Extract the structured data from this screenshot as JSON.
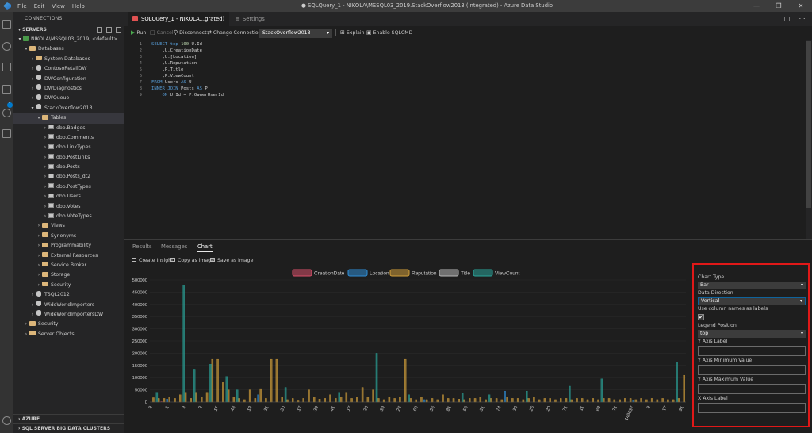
{
  "titlebar": {
    "menu": [
      "File",
      "Edit",
      "View",
      "Help"
    ],
    "window_title": "● SQLQuery_1 - NIKOLA\\MSSQL03_2019.StackOverflow2013 (Integrated) - Azure Data Studio"
  },
  "activity_badge": "1",
  "sidebar": {
    "section_title": "CONNECTIONS",
    "servers_label": "SERVERS",
    "tree": [
      {
        "label": "NIKOLA\\MSSQL03_2019, <default>...",
        "icon": "server",
        "chevron": "▾",
        "indent": 0
      },
      {
        "label": "Databases",
        "icon": "folder",
        "chevron": "▾",
        "indent": 1
      },
      {
        "label": "System Databases",
        "icon": "folder",
        "chevron": "›",
        "indent": 2
      },
      {
        "label": "ContosoRetailDW",
        "icon": "db",
        "chevron": "›",
        "indent": 2
      },
      {
        "label": "DWConfiguration",
        "icon": "db",
        "chevron": "›",
        "indent": 2
      },
      {
        "label": "DWDiagnostics",
        "icon": "db",
        "chevron": "›",
        "indent": 2
      },
      {
        "label": "DWQueue",
        "icon": "db",
        "chevron": "›",
        "indent": 2
      },
      {
        "label": "StackOverflow2013",
        "icon": "db",
        "chevron": "▾",
        "indent": 2
      },
      {
        "label": "Tables",
        "icon": "folder",
        "chevron": "▾",
        "indent": 3,
        "selected": true
      },
      {
        "label": "dbo.Badges",
        "icon": "table",
        "chevron": "›",
        "indent": 4
      },
      {
        "label": "dbo.Comments",
        "icon": "table",
        "chevron": "›",
        "indent": 4
      },
      {
        "label": "dbo.LinkTypes",
        "icon": "table",
        "chevron": "›",
        "indent": 4
      },
      {
        "label": "dbo.PostLinks",
        "icon": "table",
        "chevron": "›",
        "indent": 4
      },
      {
        "label": "dbo.Posts",
        "icon": "table",
        "chevron": "›",
        "indent": 4
      },
      {
        "label": "dbo.Posts_dt2",
        "icon": "table",
        "chevron": "›",
        "indent": 4
      },
      {
        "label": "dbo.PostTypes",
        "icon": "table",
        "chevron": "›",
        "indent": 4
      },
      {
        "label": "dbo.Users",
        "icon": "table",
        "chevron": "›",
        "indent": 4
      },
      {
        "label": "dbo.Votes",
        "icon": "table",
        "chevron": "›",
        "indent": 4
      },
      {
        "label": "dbo.VoteTypes",
        "icon": "table",
        "chevron": "›",
        "indent": 4
      },
      {
        "label": "Views",
        "icon": "folder",
        "chevron": "›",
        "indent": 3
      },
      {
        "label": "Synonyms",
        "icon": "folder",
        "chevron": "›",
        "indent": 3
      },
      {
        "label": "Programmability",
        "icon": "folder",
        "chevron": "›",
        "indent": 3
      },
      {
        "label": "External Resources",
        "icon": "folder",
        "chevron": "›",
        "indent": 3
      },
      {
        "label": "Service Broker",
        "icon": "folder",
        "chevron": "›",
        "indent": 3
      },
      {
        "label": "Storage",
        "icon": "folder",
        "chevron": "›",
        "indent": 3
      },
      {
        "label": "Security",
        "icon": "folder",
        "chevron": "›",
        "indent": 3
      },
      {
        "label": "TSQL2012",
        "icon": "db",
        "chevron": "›",
        "indent": 2
      },
      {
        "label": "WideWorldImporters",
        "icon": "db",
        "chevron": "›",
        "indent": 2
      },
      {
        "label": "WideWorldImportersDW",
        "icon": "db",
        "chevron": "›",
        "indent": 2
      },
      {
        "label": "Security",
        "icon": "folder",
        "chevron": "›",
        "indent": 1
      },
      {
        "label": "Server Objects",
        "icon": "folder",
        "chevron": "›",
        "indent": 1
      }
    ],
    "azure_label": "AZURE",
    "bigdata_label": "SQL SERVER BIG DATA CLUSTERS"
  },
  "tabs": {
    "query_tab": "SQLQuery_1 - NIKOLA...grated)",
    "settings_tab": "Settings"
  },
  "toolbar": {
    "run": "Run",
    "cancel": "Cancel",
    "disconnect": "Disconnect",
    "change_connection": "Change Connection",
    "database": "StackOverflow2013",
    "explain": "Explain",
    "enable_sqlcmd": "Enable SQLCMD"
  },
  "code": [
    {
      "n": "1",
      "parts": [
        [
          "kw",
          "SELECT "
        ],
        [
          "kw",
          "top "
        ],
        [
          "num",
          "100 "
        ],
        [
          "tx",
          "U.Id"
        ]
      ]
    },
    {
      "n": "2",
      "parts": [
        [
          "tx",
          "    ,U.CreationDate"
        ]
      ]
    },
    {
      "n": "3",
      "parts": [
        [
          "tx",
          "    ,U.[Location]"
        ]
      ]
    },
    {
      "n": "4",
      "parts": [
        [
          "tx",
          "    ,U.Reputation"
        ]
      ]
    },
    {
      "n": "5",
      "parts": [
        [
          "tx",
          "    ,P.Title"
        ]
      ]
    },
    {
      "n": "6",
      "parts": [
        [
          "tx",
          "    ,P.ViewCount"
        ]
      ]
    },
    {
      "n": "7",
      "parts": [
        [
          "kw",
          "FROM "
        ],
        [
          "tx",
          "Users "
        ],
        [
          "kw",
          "AS "
        ],
        [
          "tx",
          "U"
        ]
      ]
    },
    {
      "n": "8",
      "parts": [
        [
          "kw",
          "INNER JOIN "
        ],
        [
          "tx",
          "Posts "
        ],
        [
          "kw",
          "AS "
        ],
        [
          "tx",
          "P"
        ]
      ]
    },
    {
      "n": "9",
      "parts": [
        [
          "kw",
          "    ON "
        ],
        [
          "tx",
          "U.Id = P.OwnerUserId"
        ]
      ]
    }
  ],
  "results_tabs": {
    "results": "Results",
    "messages": "Messages",
    "chart": "Chart"
  },
  "chart_actions": {
    "create_insight": "Create Insight",
    "copy_image": "Copy as image",
    "save_image": "Save as image"
  },
  "colors": {
    "CreationDate": "#d9506a",
    "Location": "#2f8fd8",
    "Reputation": "#d4a03a",
    "Title": "#b8b8b8",
    "ViewCount": "#2aa59b"
  },
  "chart_data": {
    "type": "bar",
    "legend": [
      "CreationDate",
      "Location",
      "Reputation",
      "Title",
      "ViewCount"
    ],
    "legend_position": "top",
    "ylim": [
      0,
      500000
    ],
    "yticks": [
      "0",
      "50000",
      "100000",
      "150000",
      "200000",
      "250000",
      "300000",
      "350000",
      "400000",
      "450000",
      "500000"
    ],
    "x_tick_labels": [
      "8",
      "1",
      "9",
      "2",
      "17",
      "48",
      "13",
      "31",
      "30",
      "17",
      "39",
      "41",
      "17",
      "26",
      "39",
      "26",
      "60",
      "56",
      "81",
      "56",
      "31",
      "74",
      "36",
      "26",
      "20",
      "71",
      "11",
      "63",
      "71",
      "149637",
      "8",
      "17",
      "91"
    ],
    "reputation": [
      18000,
      15000,
      15000,
      20000,
      15000,
      30000,
      40000,
      15000,
      40000,
      22000,
      40000,
      175000,
      175000,
      80000,
      50000,
      20000,
      15000,
      10000,
      50000,
      15000,
      55000,
      15000,
      175000,
      175000,
      20000,
      10000,
      15000,
      5000,
      15000,
      50000,
      20000,
      12000,
      15000,
      30000,
      15000,
      20000,
      40000,
      15000,
      20000,
      60000,
      20000,
      50000,
      15000,
      10000,
      20000,
      15000,
      20000,
      175000,
      15000,
      10000,
      20000,
      10000,
      15000,
      10000,
      30000,
      15000,
      15000,
      12000,
      10000,
      15000,
      15000,
      20000,
      10000,
      15000,
      15000,
      10000,
      20000,
      15000,
      15000,
      10000,
      15000,
      20000,
      10000,
      15000,
      15000,
      10000,
      15000,
      15000,
      10000,
      15000,
      15000,
      10000,
      15000,
      10000,
      15000,
      15000,
      10000,
      10000,
      15000,
      15000,
      10000,
      15000,
      10000,
      15000,
      10000,
      15000,
      10000,
      10000,
      15000,
      110000
    ],
    "viewcount": [
      {
        "i": 1,
        "v": 40000
      },
      {
        "i": 6,
        "v": 480000
      },
      {
        "i": 8,
        "v": 135000
      },
      {
        "i": 11,
        "v": 155000
      },
      {
        "i": 14,
        "v": 105000
      },
      {
        "i": 16,
        "v": 50000
      },
      {
        "i": 25,
        "v": 60000
      },
      {
        "i": 35,
        "v": 40000
      },
      {
        "i": 42,
        "v": 200000
      },
      {
        "i": 48,
        "v": 30000
      },
      {
        "i": 58,
        "v": 35000
      },
      {
        "i": 63,
        "v": 30000
      },
      {
        "i": 70,
        "v": 45000
      },
      {
        "i": 78,
        "v": 65000
      },
      {
        "i": 84,
        "v": 95000
      },
      {
        "i": 98,
        "v": 165000
      }
    ],
    "location": [
      {
        "i": 3,
        "v": 12000
      },
      {
        "i": 20,
        "v": 30000
      },
      {
        "i": 51,
        "v": 10000
      },
      {
        "i": 66,
        "v": 45000
      },
      {
        "i": 90,
        "v": 8000
      }
    ],
    "creationdate": [
      {
        "i": 2,
        "v": 2000
      }
    ]
  },
  "options": {
    "chart_type_label": "Chart Type",
    "chart_type_value": "Bar",
    "data_direction_label": "Data Direction",
    "data_direction_value": "Vertical",
    "use_column_names_label": "Use column names as labels",
    "use_column_names_checked": "✔",
    "legend_position_label": "Legend Position",
    "legend_position_value": "top",
    "y_axis_label": "Y Axis Label",
    "y_axis_min_label": "Y Axis Minimum Value",
    "y_axis_max_label": "Y Axis Maximum Value",
    "x_axis_label": "X Axis Label",
    "caret": "▾"
  }
}
